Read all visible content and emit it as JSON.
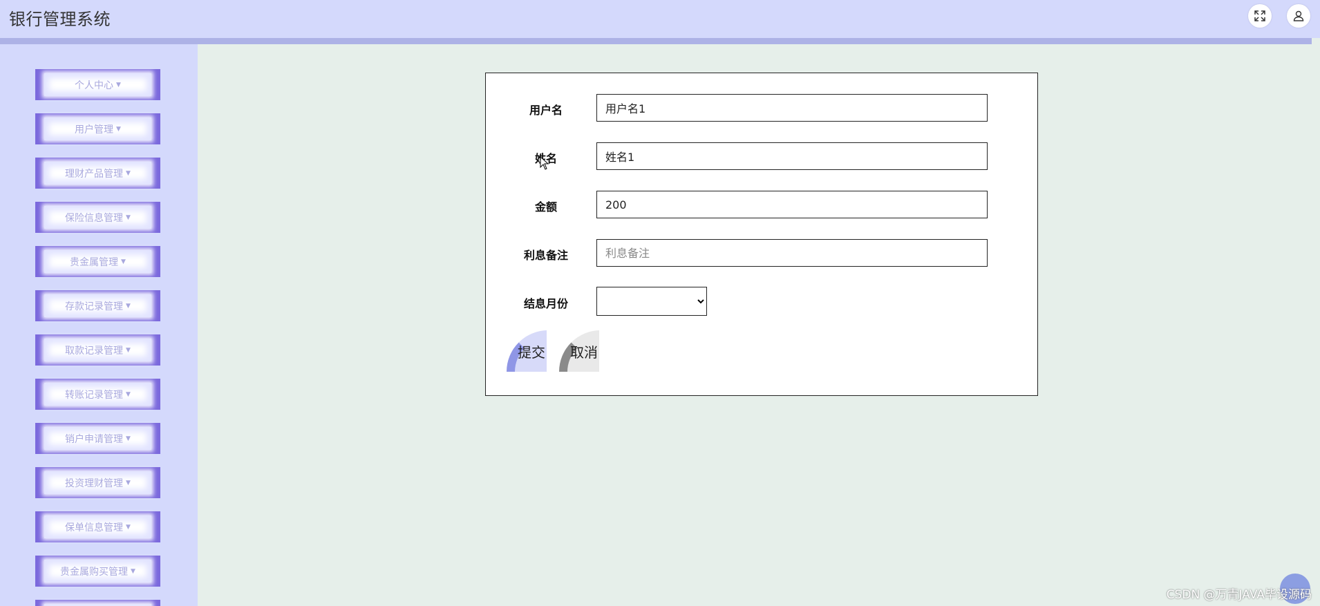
{
  "header": {
    "title": "银行管理系统",
    "fullscreen_icon": "expand-icon",
    "user_icon": "user-icon"
  },
  "sidebar": {
    "items": [
      {
        "label": "个人中心"
      },
      {
        "label": "用户管理"
      },
      {
        "label": "理财产品管理"
      },
      {
        "label": "保险信息管理"
      },
      {
        "label": "贵金属管理"
      },
      {
        "label": "存款记录管理"
      },
      {
        "label": "取款记录管理"
      },
      {
        "label": "转账记录管理"
      },
      {
        "label": "销户申请管理"
      },
      {
        "label": "投资理财管理"
      },
      {
        "label": "保单信息管理"
      },
      {
        "label": "贵金属购买管理"
      }
    ],
    "caret_icon": "caret-down-icon"
  },
  "form": {
    "username": {
      "label": "用户名",
      "value": "用户名1"
    },
    "name": {
      "label": "姓名",
      "value": "姓名1"
    },
    "amount": {
      "label": "金额",
      "value": "200"
    },
    "interest_note": {
      "label": "利息备注",
      "value": "",
      "placeholder": "利息备注"
    },
    "settle_month": {
      "label": "结息月份",
      "value": ""
    },
    "submit_label": "提交",
    "cancel_label": "取消"
  },
  "watermark": "CSDN @万青JAVA毕设源码",
  "colors": {
    "header_bg": "#d4d9fc",
    "menu_accent": "#7b69dd",
    "content_bg": "#e6efea"
  }
}
